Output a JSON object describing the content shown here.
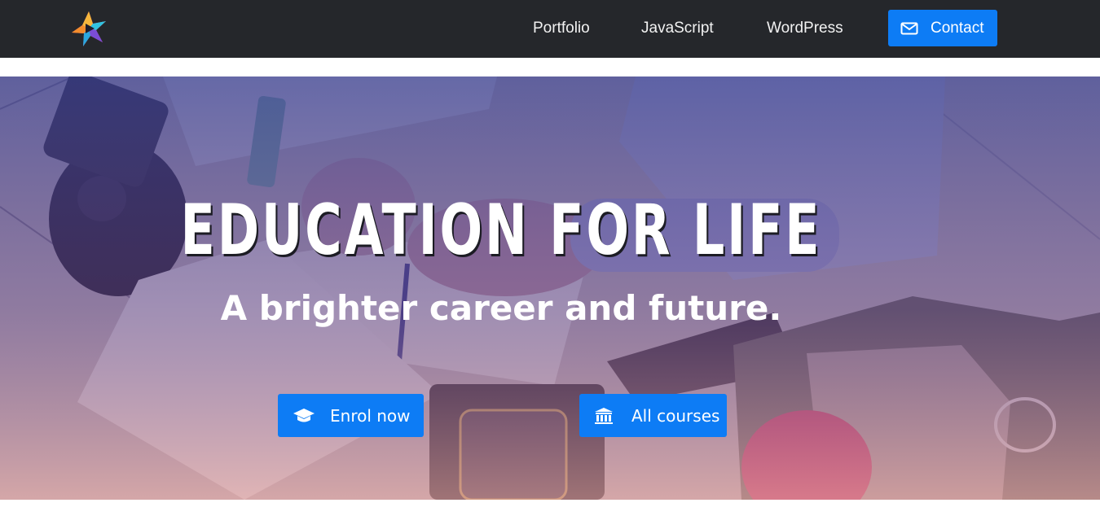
{
  "nav": {
    "logo_icon": "star-logo-icon",
    "links": [
      {
        "label": "Portfolio"
      },
      {
        "label": "JavaScript"
      },
      {
        "label": "WordPress"
      }
    ],
    "contact": {
      "label": "Contact",
      "icon": "envelope-icon"
    }
  },
  "hero": {
    "title": "EDUCATION FOR LIFE",
    "subtitle": "A brighter career and future.",
    "buttons": {
      "enrol": {
        "label": "Enrol now",
        "icon": "graduation-cap-icon"
      },
      "courses": {
        "label": "All courses",
        "icon": "university-icon"
      }
    }
  },
  "colors": {
    "navbar": "#25272b",
    "accent": "#0d7cf5",
    "overlay_top": "#3a3f8f",
    "overlay_bottom": "#d79a9a"
  }
}
